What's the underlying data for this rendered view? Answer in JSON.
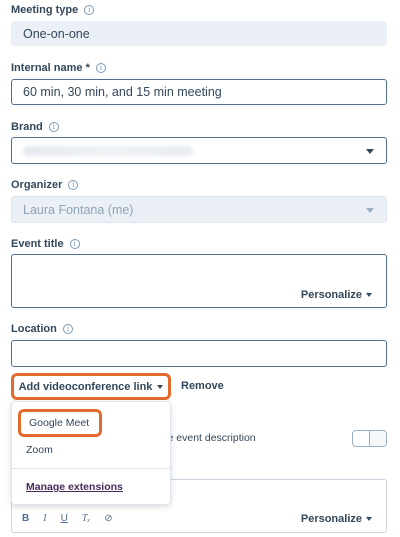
{
  "meeting_type": {
    "label": "Meeting type",
    "value": "One-on-one"
  },
  "internal_name": {
    "label": "Internal name *",
    "value": "60 min, 30 min, and 15 min meeting"
  },
  "brand": {
    "label": "Brand",
    "value": ""
  },
  "organizer": {
    "label": "Organizer",
    "value": "Laura Fontana (me)"
  },
  "event_title": {
    "label": "Event title",
    "personalize_label": "Personalize"
  },
  "location": {
    "label": "Location",
    "value": ""
  },
  "videoconference": {
    "add_button_label": "Add videoconference link",
    "remove_label": "Remove",
    "menu": {
      "items": [
        "Google Meet",
        "Zoom"
      ],
      "manage_link": "Manage extensions"
    }
  },
  "description_toggle_text": "n the event description",
  "editor": {
    "personalize_label": "Personalize",
    "toolbar": [
      "B",
      "I",
      "U",
      "Tₓ",
      "⊘"
    ]
  },
  "colors": {
    "highlight": "#e26a2c",
    "text": "#33475b",
    "readonly_bg": "#eaf0f6",
    "link": "#4a2a5a"
  }
}
